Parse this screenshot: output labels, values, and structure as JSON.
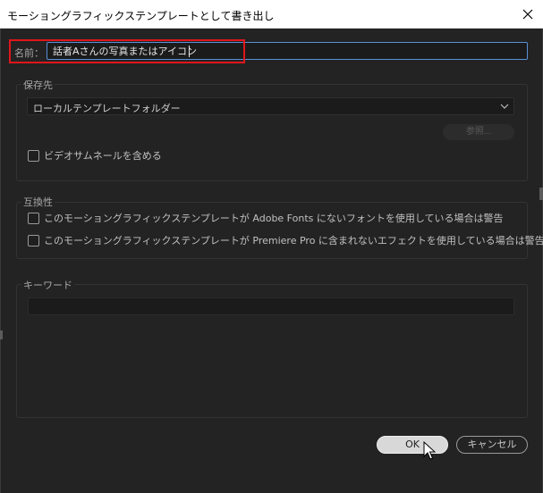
{
  "window": {
    "title": "モーショングラフィックステンプレートとして書き出し"
  },
  "name_field": {
    "label": "名前：",
    "value": "話者Aさんの写真またはアイコン",
    "highlight_color": "#e0161b"
  },
  "destination": {
    "section_label": "保存先",
    "selected": "ローカルテンプレートフォルダー",
    "browse_label": "参照...",
    "thumbnail_checkbox": {
      "label": "ビデオサムネールを含める",
      "checked": false
    }
  },
  "compatibility": {
    "section_label": "互換性",
    "options": [
      {
        "label": "このモーショングラフィックステンプレートが Adobe Fonts にないフォントを使用している場合は警告",
        "checked": false
      },
      {
        "label": "このモーショングラフィックステンプレートが Premiere Pro に含まれないエフェクトを使用している場合は警告",
        "checked": false
      }
    ]
  },
  "keywords": {
    "section_label": "キーワード",
    "value": ""
  },
  "buttons": {
    "ok": "OK",
    "cancel": "キャンセル"
  },
  "icons": [
    "close-icon",
    "chevron-down-icon",
    "mouse-cursor-icon"
  ]
}
